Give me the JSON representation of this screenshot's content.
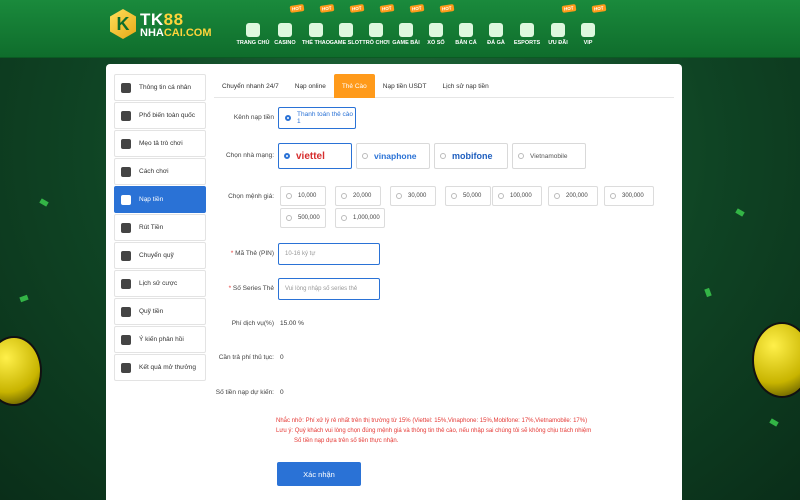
{
  "logo": {
    "brand_a": "TK",
    "brand_b": "88",
    "site_a": "NHA",
    "site_b": "CAI.COM"
  },
  "nav": [
    {
      "label": "TRANG CHỦ",
      "hot": ""
    },
    {
      "label": "CASINO",
      "hot": "HOT"
    },
    {
      "label": "THỂ THAO",
      "hot": "HOT"
    },
    {
      "label": "GAME SLOT",
      "hot": "HOT"
    },
    {
      "label": "TRÒ CHƠI",
      "hot": "HOT"
    },
    {
      "label": "GAME BÀI",
      "hot": "HOT"
    },
    {
      "label": "XỔ SỐ",
      "hot": "HOT"
    },
    {
      "label": "BẮN CÁ",
      "hot": ""
    },
    {
      "label": "ĐÁ GÀ",
      "hot": ""
    },
    {
      "label": "ESPORTS",
      "hot": ""
    },
    {
      "label": "ƯU ĐÃI",
      "hot": "HOT"
    },
    {
      "label": "VIP",
      "hot": "HOT"
    }
  ],
  "sidebar": [
    "Thông tin cá nhân",
    "Phổ biến toàn quốc",
    "Mẹo tả trò chơi",
    "Cách chơi",
    "Nạp tiền",
    "Rút Tiền",
    "Chuyển quỹ",
    "Lịch sử cược",
    "Quỹ tiền",
    "Ý kiến phản hồi",
    "Kết quả mở thưởng"
  ],
  "tabs": [
    "Chuyển nhanh 24/7",
    "Nạp online",
    "Thẻ Cào",
    "Nạp tiền USDT",
    "Lịch sử nạp tiền"
  ],
  "form": {
    "channel_label": "Kênh nạp tiền",
    "channel_value": "Thanh toán thẻ cào 1",
    "carrier_label": "Chọn nhà mạng:",
    "carriers": [
      "viettel",
      "vinaphone",
      "mobifone",
      "Vietnamobile"
    ],
    "amount_label": "Chọn mệnh giá:",
    "amounts": [
      "10,000",
      "20,000",
      "30,000",
      "50,000",
      "100,000",
      "200,000",
      "300,000",
      "500,000",
      "1,000,000"
    ],
    "pin_label": "Mã Thẻ (PIN)",
    "pin_placeholder": "10-16 ký tự",
    "serial_label": "Số Series Thẻ",
    "serial_placeholder": "Vui lòng nhập số series thẻ",
    "fee_label": "Phí dịch vụ(%)",
    "fee_value": "15.00 %",
    "fee_pay_label": "Cần trả phí thủ tục:",
    "fee_pay_value": "0",
    "expected_label": "Số tiền nạp dự kiến:",
    "expected_value": "0",
    "note_1": "Nhắc nhở: Phí xử lý rẻ nhất trên thị trường từ 15% (Viettel: 15%,Vinaphone: 15%,Mobifone: 17%,Vietnamobile: 17%)",
    "note_2": "Lưu ý: Quý khách vui lòng chọn đúng mệnh giá và thông tin thẻ cào, nếu nhập sai chúng tôi sẽ không chịu trách nhiệm",
    "note_3": "Số tiền nạp dựa trên số tiền thực nhận.",
    "submit_label": "Xác nhận"
  },
  "colors": {
    "brand_green": "#0f6d2c",
    "accent_blue": "#2a72d6",
    "tab_orange": "#ff9a1a",
    "warning_red": "#e53935"
  }
}
